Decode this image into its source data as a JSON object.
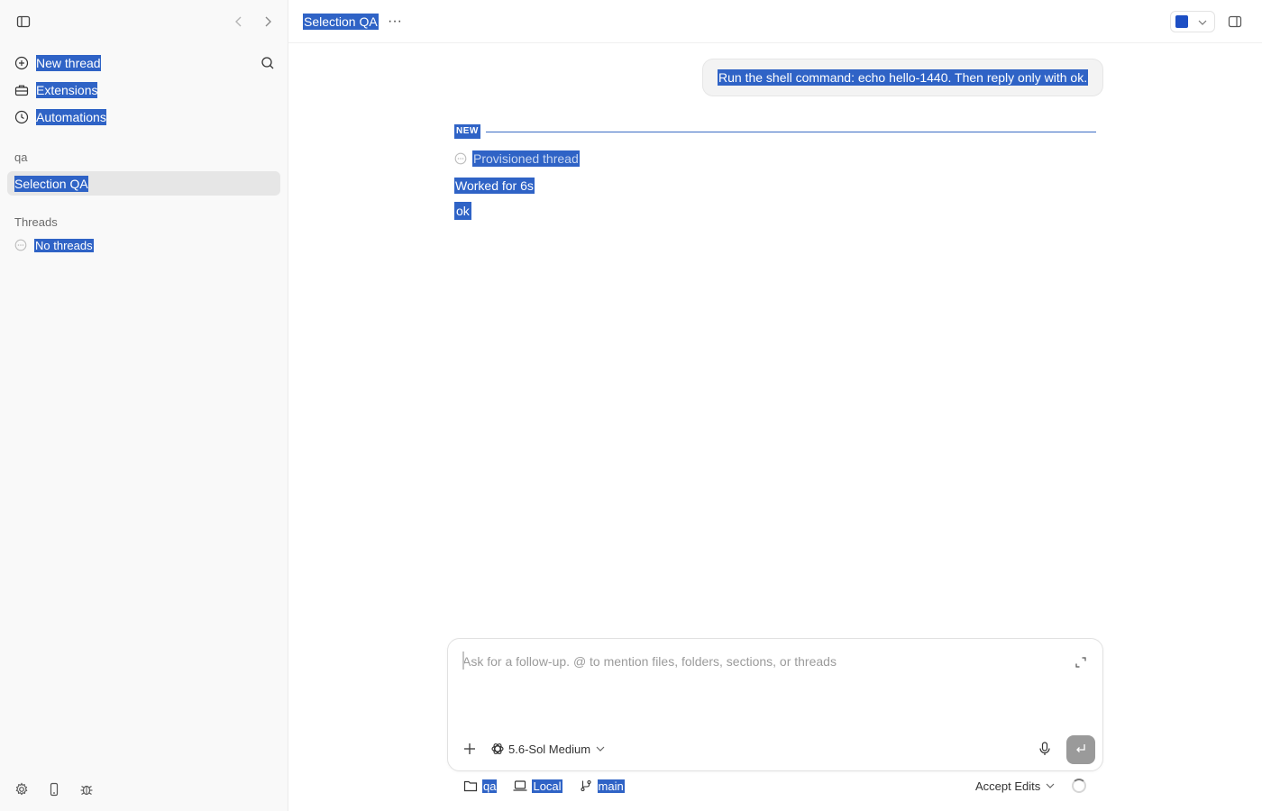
{
  "sidebar": {
    "new_thread": "New thread",
    "extensions": "Extensions",
    "automations": "Automations",
    "project_section": "qa",
    "project_item": "Selection QA",
    "threads_section": "Threads",
    "threads_empty": "No threads"
  },
  "header": {
    "title": "Selection QA",
    "more": "···"
  },
  "conversation": {
    "user_message": "Run the shell command: echo hello-1440. Then reply only with ok.",
    "new_badge": "NEW",
    "event_label": "Provisioned thread",
    "worked": "Worked for 6s",
    "reply": "ok"
  },
  "composer": {
    "placeholder": "Ask for a follow-up. @ to mention files, folders, sections, or threads",
    "value": "",
    "model": "5.6-Sol Medium",
    "folder": "qa",
    "environment": "Local",
    "branch": "main",
    "accept_mode": "Accept Edits"
  },
  "colors": {
    "selection": "#2f63c6",
    "accent": "#1d4fc4",
    "sidebar_bg": "#f9f9f9",
    "send_button": "#9a9a9a"
  },
  "icons": [
    "sidebar-toggle-icon",
    "chevron-left-icon",
    "chevron-right-icon",
    "plus-circle-icon",
    "search-icon",
    "toolbox-icon",
    "clock-icon",
    "dots-circle-icon",
    "gear-icon",
    "phone-icon",
    "bug-icon",
    "ellipsis-icon",
    "panel-icon",
    "expand-icon",
    "plus-icon",
    "openai-icon",
    "chevron-down-icon",
    "mic-icon",
    "enter-icon",
    "folder-icon",
    "laptop-icon",
    "branch-icon",
    "spinner-icon"
  ]
}
